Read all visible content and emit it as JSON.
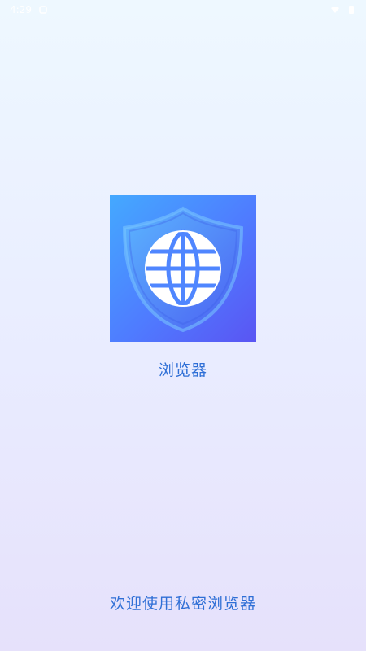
{
  "status_bar": {
    "time": "4:29",
    "icons": [
      "notification-icon",
      "wifi-icon",
      "battery-icon"
    ]
  },
  "app": {
    "name": "浏览器",
    "icon": "globe-shield-icon"
  },
  "welcome": {
    "text": "欢迎使用私密浏览器"
  },
  "colors": {
    "text_accent": "#2f6fd6",
    "icon_gradient_start": "#44a9ff",
    "icon_gradient_end": "#5a55f3"
  }
}
